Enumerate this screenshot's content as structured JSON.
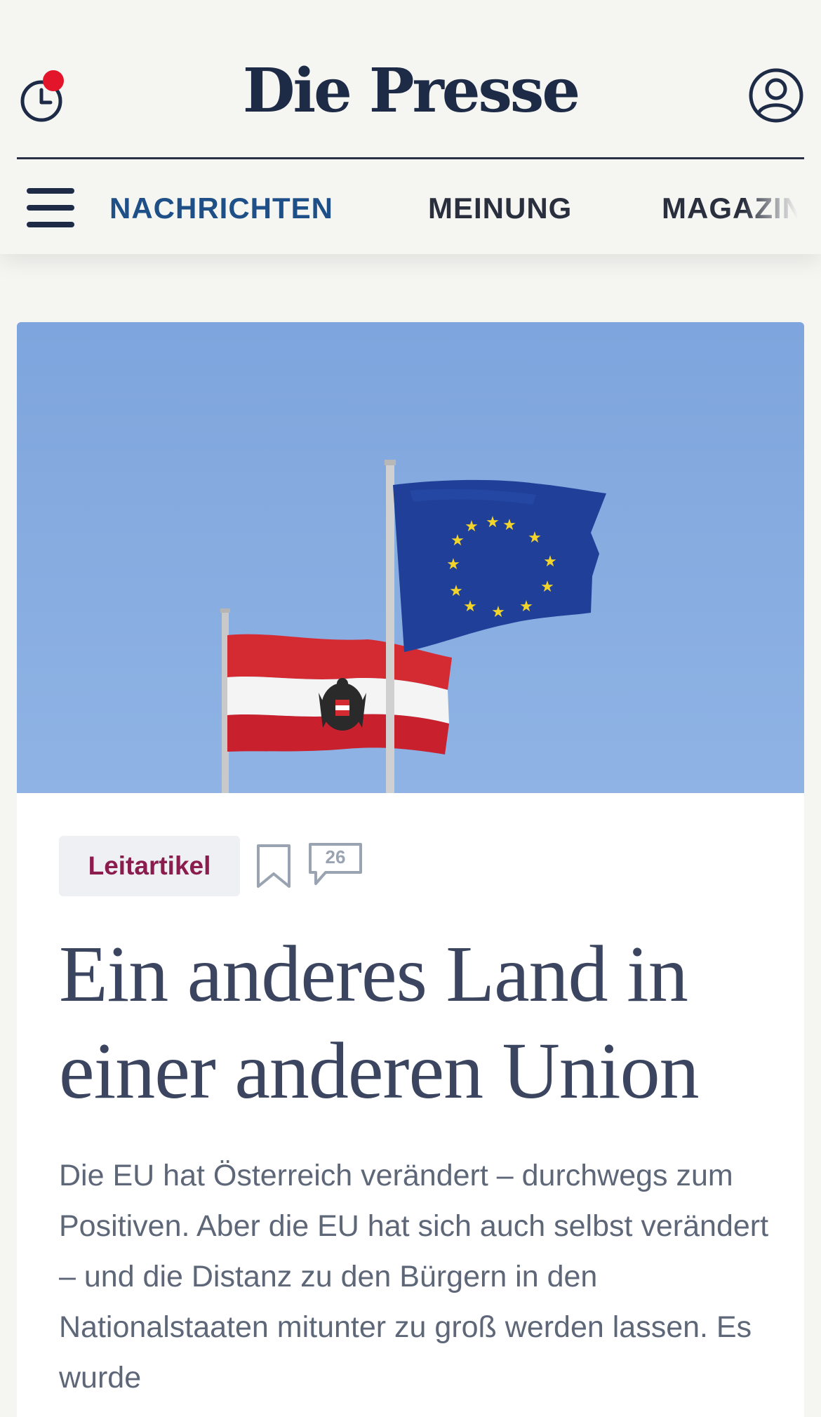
{
  "header": {
    "logo": "Die Presse",
    "history_icon": "clock-history-icon",
    "account_icon": "user-account-icon",
    "notification_dot_color": "#e3152b"
  },
  "nav": {
    "menu_icon": "hamburger-menu-icon",
    "items": [
      {
        "label": "NACHRICHTEN",
        "active": true
      },
      {
        "label": "MEINUNG",
        "active": false
      },
      {
        "label": "MAGAZIN",
        "active": false
      }
    ]
  },
  "article": {
    "hero_image": "austrian-flag-and-eu-flag-image",
    "tag": "Leitartikel",
    "bookmark_icon": "bookmark-icon",
    "comment_icon": "comment-bubble-icon",
    "comment_count": "26",
    "headline": "Ein anderes Land in einer anderen Union",
    "lead": "Die EU hat Österreich verändert – durchwegs zum Positiven. Aber die EU hat sich auch selbst verändert – und die Distanz zu den Bürgern in den Nationalstaaten mitunter zu groß werden lassen. Es wurde"
  },
  "colors": {
    "brand_navy": "#1d2b47",
    "active_nav": "#1e4f86",
    "tag_text": "#8b1c4e",
    "headline": "#3b4560"
  }
}
